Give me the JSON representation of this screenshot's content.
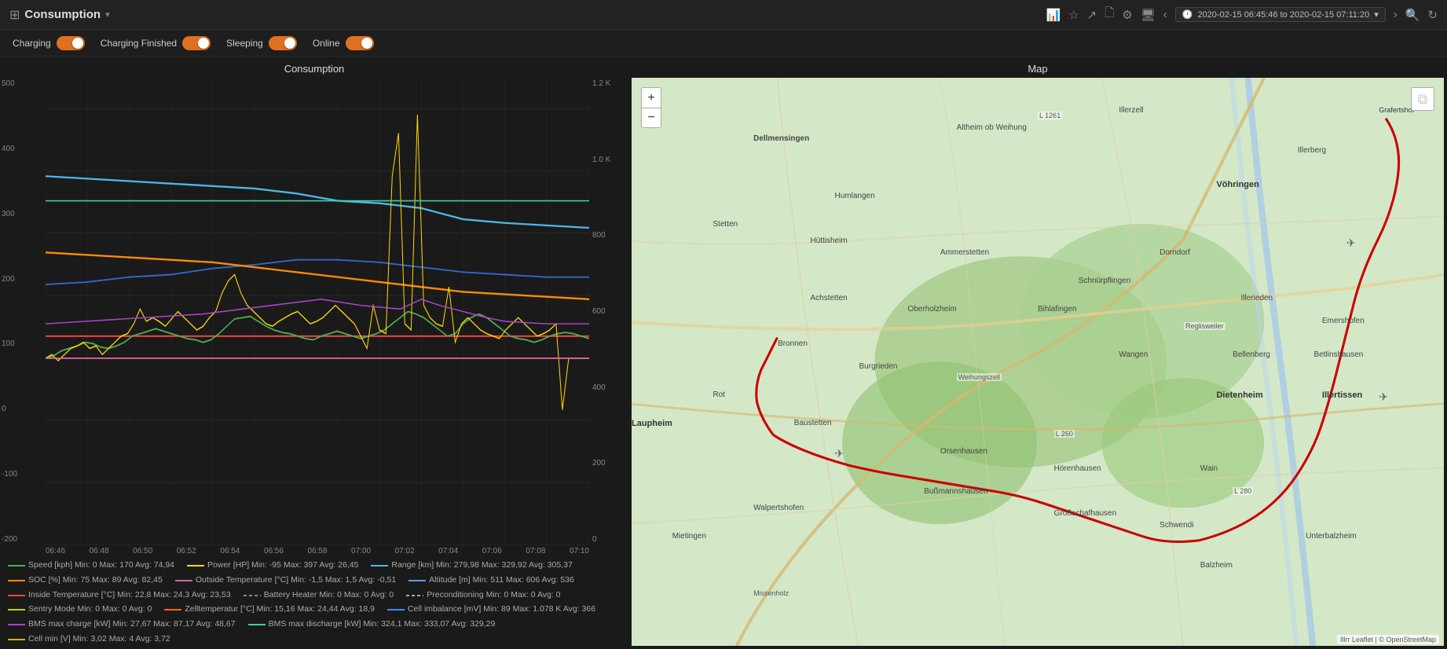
{
  "app": {
    "title": "Consumption",
    "icon": "⊞"
  },
  "navbar": {
    "date_range": "2020-02-15 06:45:46 to 2020-02-15 07:11:20",
    "icons": [
      "bar-chart",
      "star",
      "share",
      "file",
      "gear",
      "monitor",
      "chevron-left",
      "clock",
      "chevron-right",
      "search",
      "refresh"
    ]
  },
  "toggles": [
    {
      "label": "Charging",
      "on": true
    },
    {
      "label": "Charging Finished",
      "on": true
    },
    {
      "label": "Sleeping",
      "on": true
    },
    {
      "label": "Online",
      "on": true
    }
  ],
  "chart": {
    "title": "Consumption",
    "y_left_ticks": [
      "-200",
      "-100",
      "0",
      "100",
      "200",
      "300",
      "400",
      "500"
    ],
    "y_right_ticks": [
      "0",
      "200",
      "400",
      "600",
      "800",
      "1.0 K",
      "1.2 K"
    ],
    "x_ticks": [
      "06:46",
      "06:48",
      "06:50",
      "06:52",
      "06:54",
      "06:56",
      "06:58",
      "07:00",
      "07:02",
      "07:04",
      "07:06",
      "07:08",
      "07:10"
    ]
  },
  "legend": [
    {
      "color": "#4caf50",
      "dash": false,
      "text": "Speed [kph]  Min: 0  Max: 170  Avg: 74,94"
    },
    {
      "color": "#ffd700",
      "dash": false,
      "text": "Power [HP]  Min: -95  Max: 397  Avg: 26,45"
    },
    {
      "color": "#4db6e8",
      "dash": false,
      "text": "Range [km]  Min: 279,98  Max: 329,92  Avg: 305,37"
    },
    {
      "color": "#ff8c00",
      "dash": false,
      "text": "SOC [%]  Min: 75  Max: 89  Avg: 82,45"
    },
    {
      "color": "#e060a0",
      "dash": false,
      "text": "Outside Temperature [°C]  Min: -1,5  Max: 1,5  Avg: -0,51"
    },
    {
      "color": "#6699ff",
      "dash": false,
      "text": "Altitude [m]  Min: 511  Max: 606  Avg: 536"
    },
    {
      "color": "#ff4444",
      "dash": false,
      "text": "Inside Temperature [°C]  Min: 22,8  Max: 24,3  Avg: 23,53"
    },
    {
      "color": "#888",
      "dash": true,
      "text": "Battery Heater  Min: 0  Max: 0  Avg: 0"
    },
    {
      "color": "#aaa",
      "dash": true,
      "text": "Preconditioning  Min: 0  Max: 0  Avg: 0"
    },
    {
      "color": "#cccc00",
      "dash": false,
      "text": "Sentry Mode  Min: 0  Max: 0  Avg: 0"
    },
    {
      "color": "#ff6600",
      "dash": false,
      "text": "Zelltemperatur [°C]  Min: 15,16  Max: 24,44  Avg: 18,9"
    },
    {
      "color": "#4488ff",
      "dash": false,
      "text": "Cell imbalance [mV]  Min: 89  Max: 1.078 K  Avg: 366"
    },
    {
      "color": "#aa44cc",
      "dash": false,
      "text": "BMS max charge [kW]  Min: 27,67  Max: 87,17  Avg: 48,67"
    },
    {
      "color": "#44ccaa",
      "dash": false,
      "text": "BMS max discharge [kW]  Min: 324,1  Max: 333,07  Avg: 329,29"
    },
    {
      "color": "#ddaa00",
      "dash": false,
      "text": "Cell min [V]  Min: 3,02  Max: 4  Avg: 3,72"
    }
  ],
  "map": {
    "title": "Map",
    "zoom_in": "+",
    "zoom_out": "−",
    "attribution": "Illrr Leaflet | © OpenStreetMap"
  }
}
